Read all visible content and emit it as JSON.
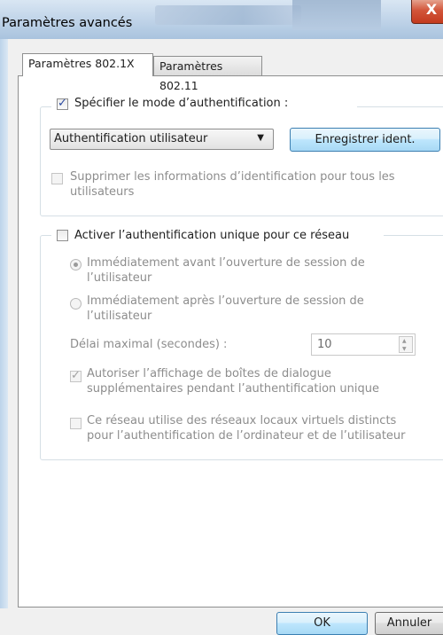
{
  "window": {
    "title": "Paramètres avancés",
    "close_glyph": "X"
  },
  "tabs": [
    {
      "label": "Paramètres 802.1X",
      "active": true
    },
    {
      "label": "Paramètres 802.11",
      "active": false
    }
  ],
  "auth_group": {
    "specify_mode_label": "Spécifier le mode d’authentification :",
    "specify_mode_checked": true,
    "mode_select_value": "Authentification utilisateur",
    "save_credentials_label": "Enregistrer ident.",
    "delete_credentials_line1": "Supprimer les informations d’identification pour tous les",
    "delete_credentials_line2": "utilisateurs",
    "delete_credentials_checked": false
  },
  "sso_group": {
    "enable_sso_label": "Activer l’authentification unique pour ce réseau",
    "enable_sso_checked": false,
    "radio_before_line1": "Immédiatement avant l’ouverture de session de",
    "radio_before_line2": "l’utilisateur",
    "radio_after_line1": "Immédiatement après l’ouverture de session de",
    "radio_after_line2": "l’utilisateur",
    "max_delay_label": "Délai maximal (secondes) :",
    "max_delay_value": "10",
    "allow_dialogs_line1": "Autoriser l’affichage de boîtes de dialogue",
    "allow_dialogs_line2": "supplémentaires pendant l’authentification unique",
    "allow_dialogs_checked": true,
    "vlan_line1": "Ce réseau utilise des réseaux locaux virtuels distincts",
    "vlan_line2": "pour l’authentification de l’ordinateur et de l’utilisateur",
    "vlan_checked": false
  },
  "footer": {
    "ok_label": "OK",
    "cancel_label": "Annuler"
  },
  "colors": {
    "accent": "#3c7fb1",
    "close": "#c33a1e",
    "disabled_text": "#8d8d8d"
  }
}
